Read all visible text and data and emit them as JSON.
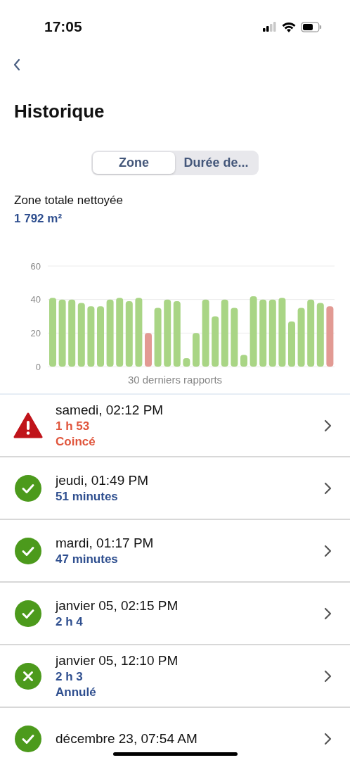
{
  "status_bar": {
    "time": "17:05"
  },
  "header": {
    "title": "Historique"
  },
  "tabs": [
    {
      "label": "Zone",
      "selected": true
    },
    {
      "label": "Durée de...",
      "selected": false
    }
  ],
  "summary": {
    "label": "Zone totale nettoyée",
    "value": "1 792 m²"
  },
  "chart_data": {
    "type": "bar",
    "xlabel": "30 derniers rapports",
    "ylim": [
      0,
      60
    ],
    "yticks": [
      0,
      20,
      40,
      60
    ],
    "series": [
      {
        "color": "#a9d585",
        "values": [
          41,
          40,
          40,
          38,
          36,
          36,
          40,
          41,
          39,
          41,
          null,
          35,
          40,
          39,
          5,
          20,
          40,
          30,
          40,
          35,
          7,
          42,
          40,
          40,
          41,
          27,
          35,
          40,
          38,
          null
        ]
      },
      {
        "color": "#e29a93",
        "values": [
          null,
          null,
          null,
          null,
          null,
          null,
          null,
          null,
          null,
          null,
          20,
          null,
          null,
          null,
          null,
          null,
          null,
          null,
          null,
          null,
          null,
          null,
          null,
          null,
          null,
          null,
          null,
          null,
          null,
          36
        ]
      }
    ]
  },
  "reports": [
    {
      "kind": "warning",
      "title": "samedi, 02:12 PM",
      "duration": "1 h 53",
      "note": "Coincé"
    },
    {
      "kind": "done",
      "title": "jeudi, 01:49 PM",
      "duration": "51 minutes"
    },
    {
      "kind": "done",
      "title": "mardi, 01:17 PM",
      "duration": "47 minutes"
    },
    {
      "kind": "done",
      "title": "janvier 05, 02:15 PM",
      "duration": "2 h 4"
    },
    {
      "kind": "cancelled",
      "title": "janvier 05, 12:10 PM",
      "duration": "2 h 3",
      "note": "Annulé"
    },
    {
      "kind": "done",
      "title": "décembre 23, 07:54 AM"
    }
  ]
}
